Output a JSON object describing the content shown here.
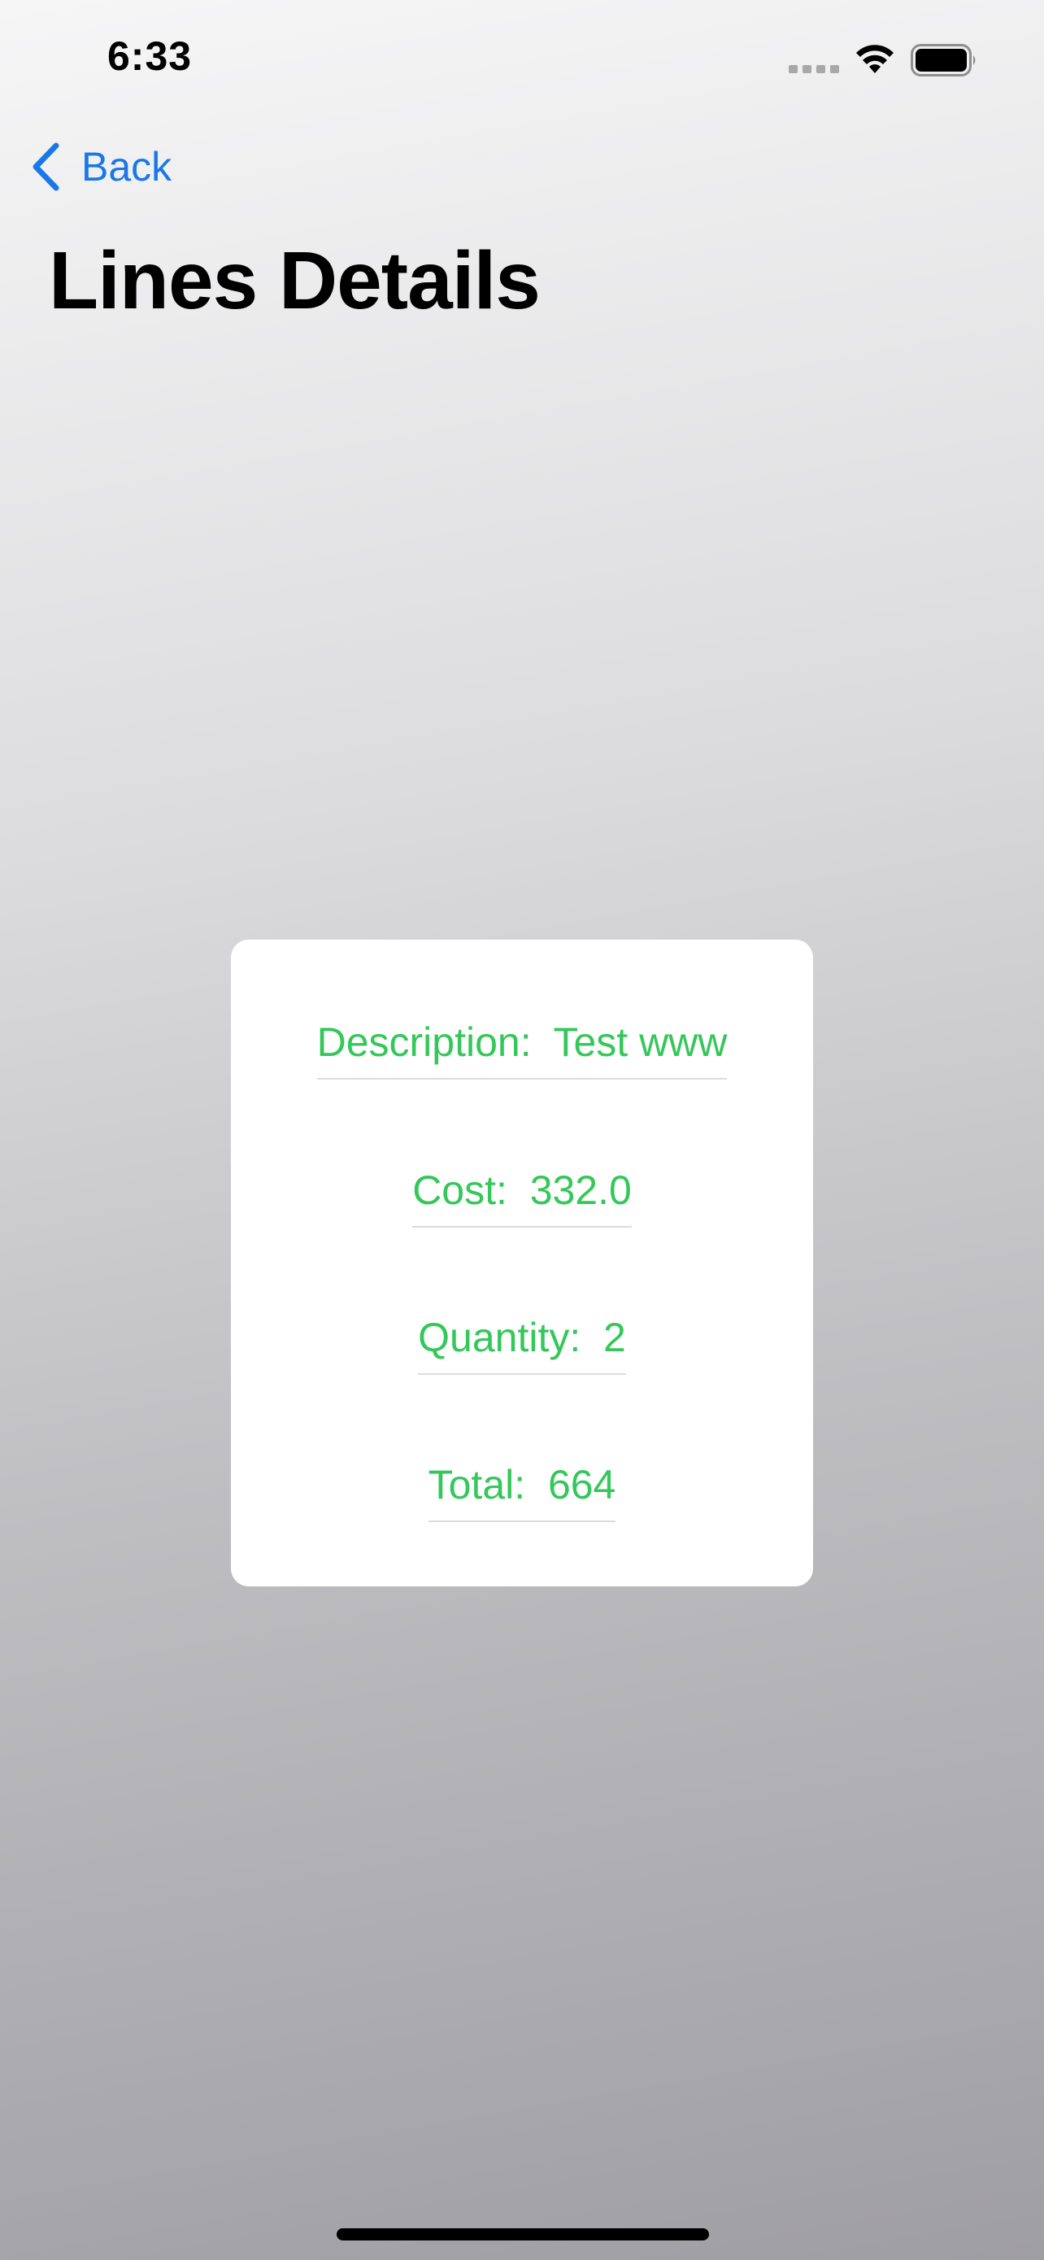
{
  "status_bar": {
    "time": "6:33",
    "icons": [
      "signal-icon",
      "wifi-icon",
      "battery-icon"
    ]
  },
  "nav": {
    "back_label": "Back",
    "back_icon": "chevron-left-icon"
  },
  "page": {
    "title": "Lines Details"
  },
  "details": {
    "description_label": "Description:",
    "description_value": "Test www",
    "cost_label": "Cost:",
    "cost_value": "332.0",
    "quantity_label": "Quantity:",
    "quantity_value": "2",
    "total_label": "Total:",
    "total_value": "664"
  },
  "colors": {
    "accent": "#1a78e6",
    "value_text": "#34c759",
    "card_bg": "#ffffff"
  }
}
